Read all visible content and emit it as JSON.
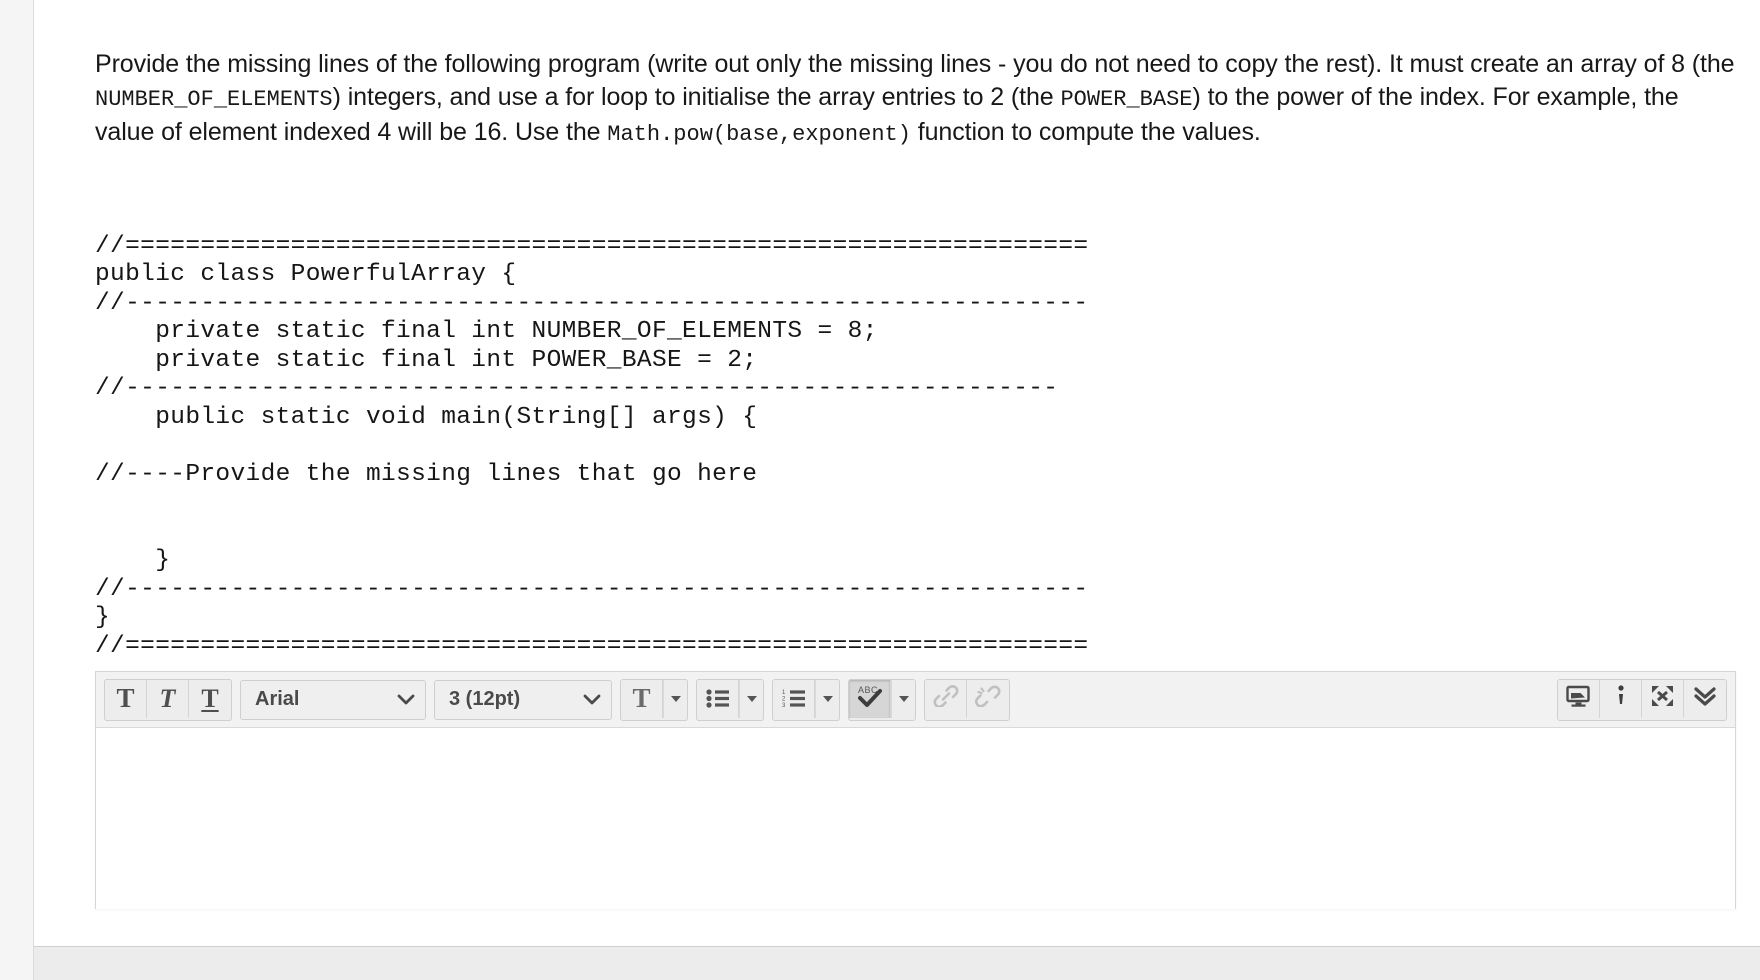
{
  "prompt": {
    "part1": "Provide the missing lines of the following program (write out only the missing lines - you do not need to copy the rest). It must create an array of 8 (the ",
    "mono1": "NUMBER_OF_ELEMENTS",
    "part2": ") integers, and use a for loop to initialise the array entries to 2 (the ",
    "mono2": "POWER_BASE",
    "part3": ") to the power of the index. For example, the value of element indexed 4 will be 16. Use the ",
    "mono3": "Math.pow(base,exponent)",
    "part4": " function to compute the values."
  },
  "code": {
    "text": "//================================================================\npublic class PowerfulArray {\n//----------------------------------------------------------------\n    private static final int NUMBER_OF_ELEMENTS = 8;\n    private static final int POWER_BASE = 2;\n//--------------------------------------------------------------\n    public static void main(String[] args) {\n\n//----Provide the missing lines that go here\n\n\n    }\n//----------------------------------------------------------------\n}\n//================================================================",
    "lines": [
      "//================================================================",
      "public class PowerfulArray {",
      "//----------------------------------------------------------------",
      "    private static final int NUMBER_OF_ELEMENTS = 8;",
      "    private static final int POWER_BASE = 2;",
      "//--------------------------------------------------------------",
      "    public static void main(String[] args) {",
      "",
      "//----Provide the missing lines that go here",
      "",
      "",
      "    }",
      "//----------------------------------------------------------------",
      "}",
      "//================================================================"
    ]
  },
  "editor": {
    "toolbar": {
      "bold_label": "T",
      "italic_label": "T",
      "underline_label": "T",
      "font_family": "Arial",
      "font_size": "3 (12pt)",
      "text_color_label": "T",
      "bullet_list_icon": "bullet-list-icon",
      "numbered_list_icon": "numbered-list-icon",
      "spellcheck_label": "ABC",
      "link_icon": "link-icon",
      "unlink_icon": "unlink-icon",
      "preview_icon": "preview-monitor-icon",
      "info_icon": "info-icon",
      "fullscreen_icon": "fullscreen-expand-icon",
      "more_icon": "chevron-double-down-icon"
    },
    "body_value": "",
    "body_placeholder": ""
  },
  "colors": {
    "toolbar_bg": "#f2f2f2",
    "button_bg": "#ededed",
    "button_active_bg": "#d6d6d6",
    "border": "#d6d6d6",
    "text": "#181818",
    "gutter": "#f5f5f5",
    "footer": "#ececec"
  }
}
